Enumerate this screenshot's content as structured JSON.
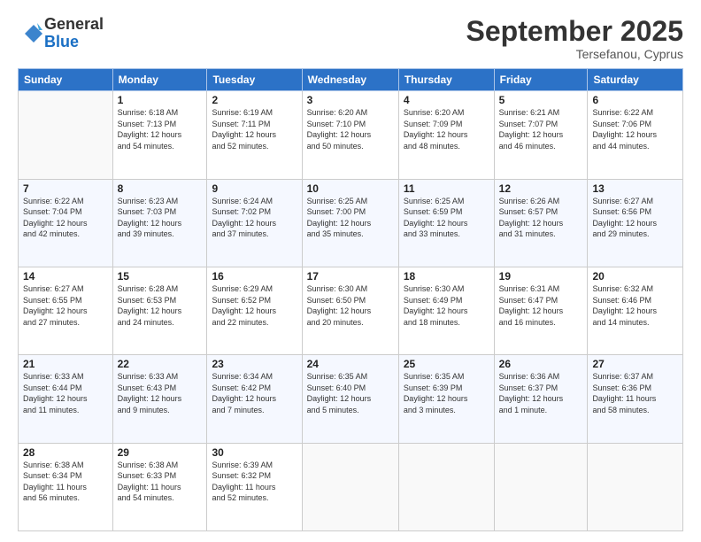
{
  "logo": {
    "general": "General",
    "blue": "Blue"
  },
  "header": {
    "month": "September 2025",
    "location": "Tersefanou, Cyprus"
  },
  "weekdays": [
    "Sunday",
    "Monday",
    "Tuesday",
    "Wednesday",
    "Thursday",
    "Friday",
    "Saturday"
  ],
  "weeks": [
    [
      {
        "day": "",
        "info": ""
      },
      {
        "day": "1",
        "info": "Sunrise: 6:18 AM\nSunset: 7:13 PM\nDaylight: 12 hours\nand 54 minutes."
      },
      {
        "day": "2",
        "info": "Sunrise: 6:19 AM\nSunset: 7:11 PM\nDaylight: 12 hours\nand 52 minutes."
      },
      {
        "day": "3",
        "info": "Sunrise: 6:20 AM\nSunset: 7:10 PM\nDaylight: 12 hours\nand 50 minutes."
      },
      {
        "day": "4",
        "info": "Sunrise: 6:20 AM\nSunset: 7:09 PM\nDaylight: 12 hours\nand 48 minutes."
      },
      {
        "day": "5",
        "info": "Sunrise: 6:21 AM\nSunset: 7:07 PM\nDaylight: 12 hours\nand 46 minutes."
      },
      {
        "day": "6",
        "info": "Sunrise: 6:22 AM\nSunset: 7:06 PM\nDaylight: 12 hours\nand 44 minutes."
      }
    ],
    [
      {
        "day": "7",
        "info": "Sunrise: 6:22 AM\nSunset: 7:04 PM\nDaylight: 12 hours\nand 42 minutes."
      },
      {
        "day": "8",
        "info": "Sunrise: 6:23 AM\nSunset: 7:03 PM\nDaylight: 12 hours\nand 39 minutes."
      },
      {
        "day": "9",
        "info": "Sunrise: 6:24 AM\nSunset: 7:02 PM\nDaylight: 12 hours\nand 37 minutes."
      },
      {
        "day": "10",
        "info": "Sunrise: 6:25 AM\nSunset: 7:00 PM\nDaylight: 12 hours\nand 35 minutes."
      },
      {
        "day": "11",
        "info": "Sunrise: 6:25 AM\nSunset: 6:59 PM\nDaylight: 12 hours\nand 33 minutes."
      },
      {
        "day": "12",
        "info": "Sunrise: 6:26 AM\nSunset: 6:57 PM\nDaylight: 12 hours\nand 31 minutes."
      },
      {
        "day": "13",
        "info": "Sunrise: 6:27 AM\nSunset: 6:56 PM\nDaylight: 12 hours\nand 29 minutes."
      }
    ],
    [
      {
        "day": "14",
        "info": "Sunrise: 6:27 AM\nSunset: 6:55 PM\nDaylight: 12 hours\nand 27 minutes."
      },
      {
        "day": "15",
        "info": "Sunrise: 6:28 AM\nSunset: 6:53 PM\nDaylight: 12 hours\nand 24 minutes."
      },
      {
        "day": "16",
        "info": "Sunrise: 6:29 AM\nSunset: 6:52 PM\nDaylight: 12 hours\nand 22 minutes."
      },
      {
        "day": "17",
        "info": "Sunrise: 6:30 AM\nSunset: 6:50 PM\nDaylight: 12 hours\nand 20 minutes."
      },
      {
        "day": "18",
        "info": "Sunrise: 6:30 AM\nSunset: 6:49 PM\nDaylight: 12 hours\nand 18 minutes."
      },
      {
        "day": "19",
        "info": "Sunrise: 6:31 AM\nSunset: 6:47 PM\nDaylight: 12 hours\nand 16 minutes."
      },
      {
        "day": "20",
        "info": "Sunrise: 6:32 AM\nSunset: 6:46 PM\nDaylight: 12 hours\nand 14 minutes."
      }
    ],
    [
      {
        "day": "21",
        "info": "Sunrise: 6:33 AM\nSunset: 6:44 PM\nDaylight: 12 hours\nand 11 minutes."
      },
      {
        "day": "22",
        "info": "Sunrise: 6:33 AM\nSunset: 6:43 PM\nDaylight: 12 hours\nand 9 minutes."
      },
      {
        "day": "23",
        "info": "Sunrise: 6:34 AM\nSunset: 6:42 PM\nDaylight: 12 hours\nand 7 minutes."
      },
      {
        "day": "24",
        "info": "Sunrise: 6:35 AM\nSunset: 6:40 PM\nDaylight: 12 hours\nand 5 minutes."
      },
      {
        "day": "25",
        "info": "Sunrise: 6:35 AM\nSunset: 6:39 PM\nDaylight: 12 hours\nand 3 minutes."
      },
      {
        "day": "26",
        "info": "Sunrise: 6:36 AM\nSunset: 6:37 PM\nDaylight: 12 hours\nand 1 minute."
      },
      {
        "day": "27",
        "info": "Sunrise: 6:37 AM\nSunset: 6:36 PM\nDaylight: 11 hours\nand 58 minutes."
      }
    ],
    [
      {
        "day": "28",
        "info": "Sunrise: 6:38 AM\nSunset: 6:34 PM\nDaylight: 11 hours\nand 56 minutes."
      },
      {
        "day": "29",
        "info": "Sunrise: 6:38 AM\nSunset: 6:33 PM\nDaylight: 11 hours\nand 54 minutes."
      },
      {
        "day": "30",
        "info": "Sunrise: 6:39 AM\nSunset: 6:32 PM\nDaylight: 11 hours\nand 52 minutes."
      },
      {
        "day": "",
        "info": ""
      },
      {
        "day": "",
        "info": ""
      },
      {
        "day": "",
        "info": ""
      },
      {
        "day": "",
        "info": ""
      }
    ]
  ]
}
